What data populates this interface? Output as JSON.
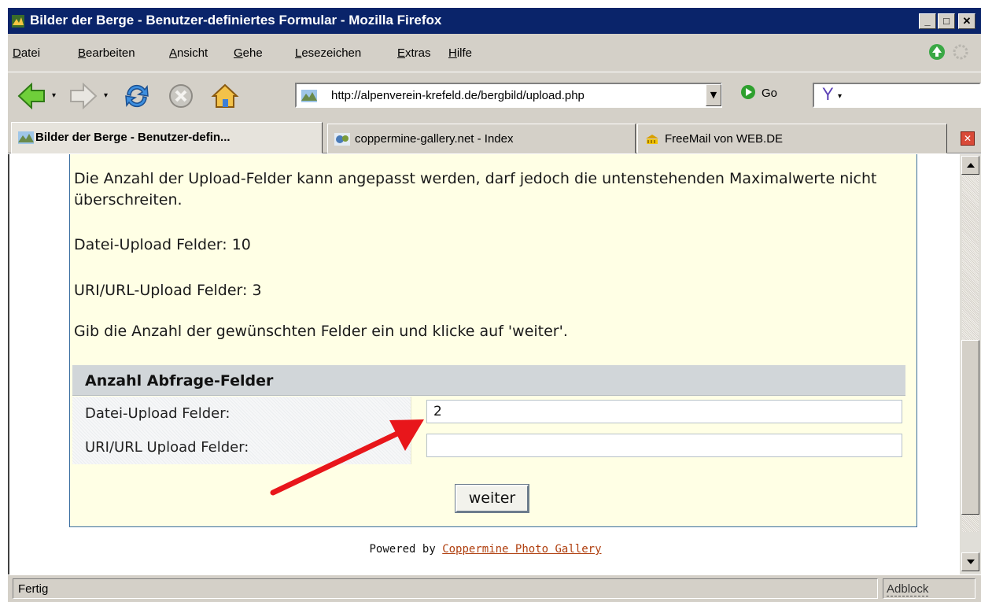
{
  "window": {
    "title": "Bilder der Berge - Benutzer-definiertes Formular - Mozilla Firefox",
    "minimize": "_",
    "maximize": "□",
    "close": "✕"
  },
  "menu": [
    "Datei",
    "Bearbeiten",
    "Ansicht",
    "Gehe",
    "Lesezeichen",
    "Extras",
    "Hilfe"
  ],
  "navigation": {
    "url": "http://alpenverein-krefeld.de/bergbild/upload.php",
    "go_label": "Go",
    "search_engine": "Y"
  },
  "tabs": [
    {
      "label": "Bilder der Berge - Benutzer-defin...",
      "active": true
    },
    {
      "label": "coppermine-gallery.net - Index",
      "active": false
    },
    {
      "label": "FreeMail von WEB.DE",
      "active": false
    }
  ],
  "page": {
    "info_text": "Die Anzahl der Upload-Felder kann angepasst werden, darf jedoch die untenstehenden Maximalwerte nicht überschreiten.",
    "file_limit": "Datei-Upload Felder: 10",
    "uri_limit": "URI/URL-Upload Felder: 3",
    "instruction": "Gib die Anzahl der gewünschten Felder ein und klicke auf 'weiter'.",
    "fieldset_title": "Anzahl Abfrage-Felder",
    "file_fields_label": "Datei-Upload Felder:",
    "file_fields_value": "2",
    "uri_fields_label": "URI/URL Upload Felder:",
    "uri_fields_value": "",
    "submit_label": "weiter",
    "footer_prefix": "Powered by ",
    "footer_link": "Coppermine Photo Gallery"
  },
  "status": {
    "text": "Fertig",
    "adblock": "Adblock"
  },
  "colors": {
    "title_bar": "#0a246a",
    "content_bg": "#ffffe5",
    "annotation_arrow": "#e8161b",
    "link": "#b04010"
  }
}
